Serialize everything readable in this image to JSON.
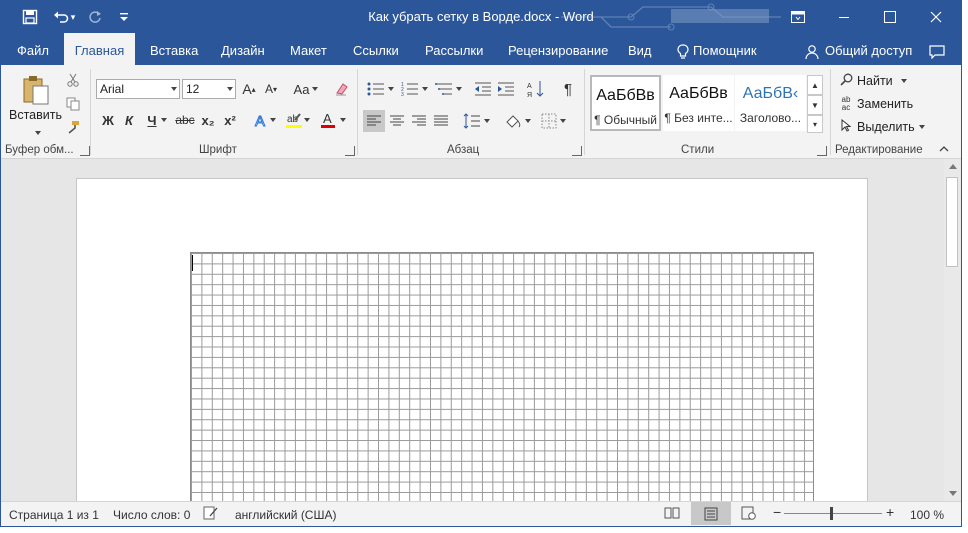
{
  "titlebar": {
    "title": "Как убрать сетку в Ворде.docx - Word",
    "qat": [
      {
        "icon": "save-icon"
      },
      {
        "icon": "undo-icon"
      },
      {
        "icon": "redo-icon"
      },
      {
        "icon": "customize-qat-icon"
      }
    ],
    "window_buttons": [
      "ribbon-display-options-icon",
      "minimize-icon",
      "maximize-icon",
      "close-icon"
    ]
  },
  "tabs": [
    {
      "label": "Файл"
    },
    {
      "label": "Главная"
    },
    {
      "label": "Вставка"
    },
    {
      "label": "Дизайн"
    },
    {
      "label": "Макет"
    },
    {
      "label": "Ссылки"
    },
    {
      "label": "Рассылки"
    },
    {
      "label": "Рецензирование"
    },
    {
      "label": "Вид"
    },
    {
      "label": "Помощник"
    }
  ],
  "share": {
    "label": "Общий доступ"
  },
  "ribbon": {
    "clipboard": {
      "paste_label": "Вставить",
      "group_label": "Буфер обм..."
    },
    "font": {
      "name": "Arial",
      "size": "12",
      "group_label": "Шрифт",
      "bold": "Ж",
      "italic": "К",
      "underline": "Ч",
      "strike": "abc",
      "subscript": "x₂",
      "superscript": "x²",
      "grow": "A",
      "shrink": "A",
      "case": "Aa"
    },
    "paragraph": {
      "group_label": "Абзац"
    },
    "styles": {
      "group_label": "Стили",
      "items": [
        {
          "sample": "АаБбВв",
          "name": "¶ Обычный"
        },
        {
          "sample": "АаБбВв",
          "name": "¶ Без инте..."
        },
        {
          "sample": "АаБбВ‹",
          "name": "Заголово..."
        }
      ]
    },
    "editing": {
      "group_label": "Редактирование",
      "find": "Найти",
      "replace": "Заменить",
      "select": "Выделить"
    }
  },
  "statusbar": {
    "page": "Страница 1 из 1",
    "words": "Число слов: 0",
    "language": "английский (США)",
    "zoom": "100 %"
  },
  "colors": {
    "accent": "#2b579a",
    "highlight": "#ffff00",
    "font_color": "#e00000"
  }
}
